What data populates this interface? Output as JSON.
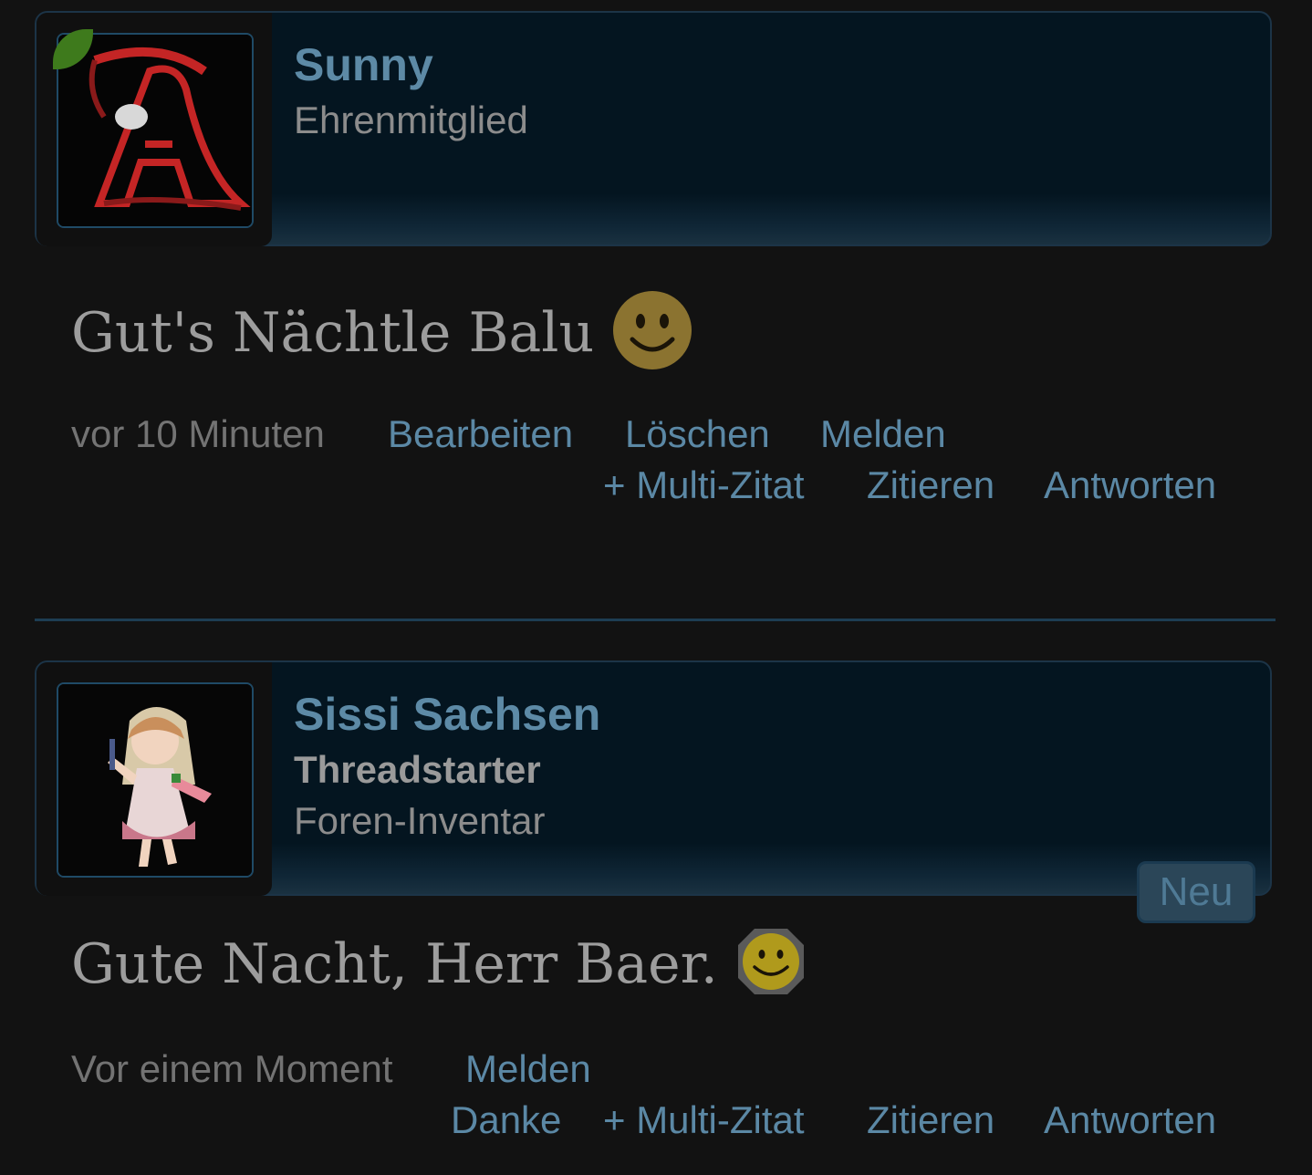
{
  "posts": [
    {
      "username": "Sunny",
      "roles": [
        "Ehrenmitglied"
      ],
      "message": "Gut's Nächtle Balu",
      "time": "vor 10 Minuten",
      "actions_row1": [
        "Bearbeiten",
        "Löschen",
        "Melden"
      ],
      "actions_row2": [
        "+ Multi-Zitat",
        "Zitieren",
        "Antworten"
      ]
    },
    {
      "username": "Sissi Sachsen",
      "badge": "Threadstarter",
      "roles": [
        "Foren-Inventar"
      ],
      "message": "Gute Nacht, Herr Baer.",
      "time": "Vor einem Moment",
      "actions_row1": [
        "Melden"
      ],
      "actions_row2": [
        "Danke",
        "+ Multi-Zitat",
        "Zitieren",
        "Antworten"
      ],
      "new_label": "Neu"
    }
  ],
  "icons": {
    "online": "online-status-icon",
    "smiley": "smiley-icon"
  },
  "colors": {
    "link": "#5b88a5",
    "online": "#3e7a1c",
    "smiley": "#8b7330"
  }
}
